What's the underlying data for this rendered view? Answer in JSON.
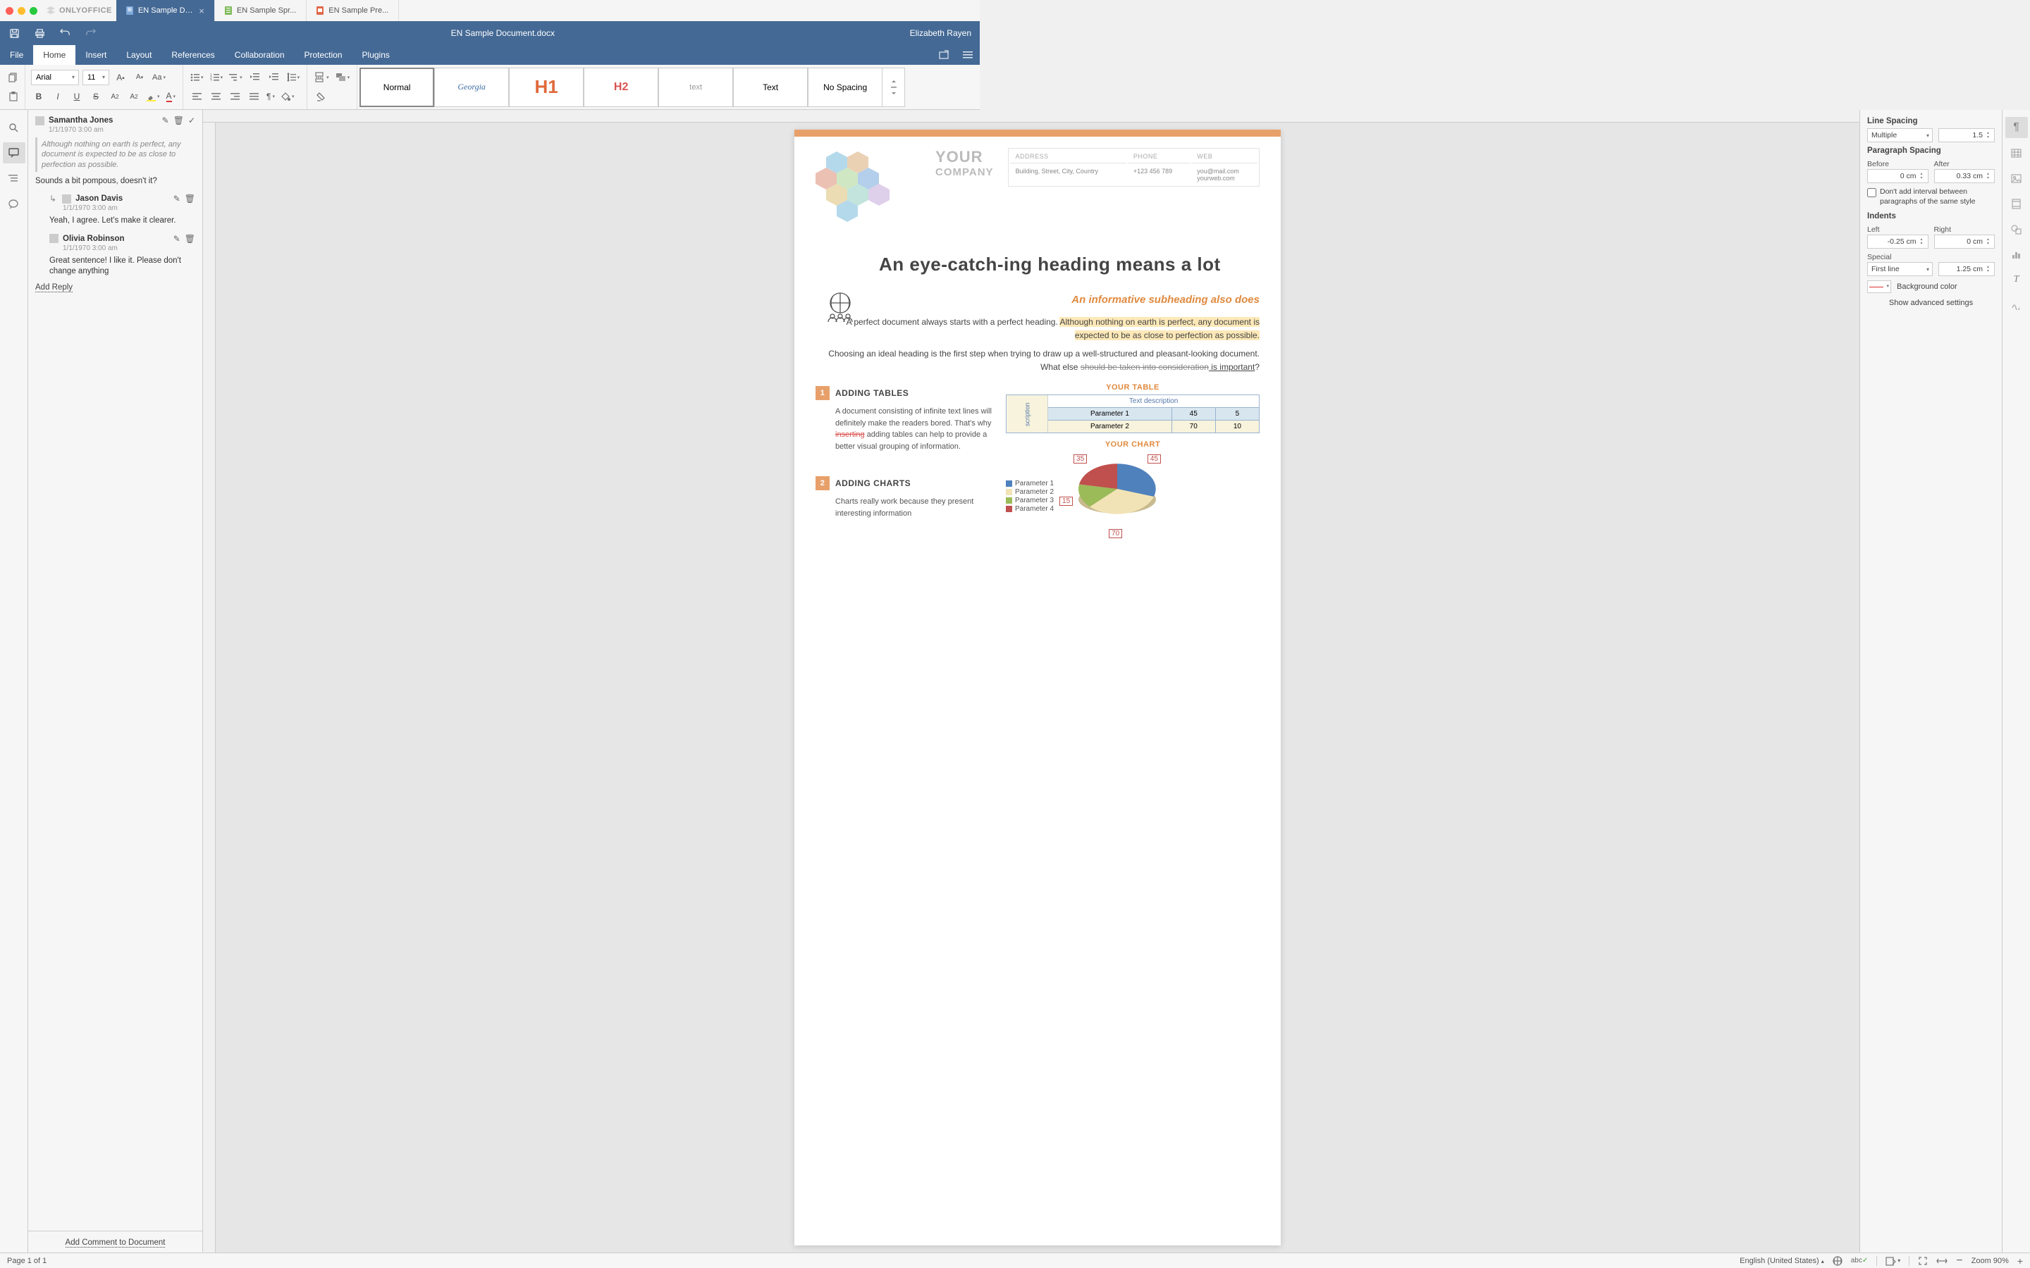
{
  "app": {
    "brand": "ONLYOFFICE"
  },
  "tabs": [
    {
      "label": "EN Sample Doc...",
      "type": "doc",
      "active": true
    },
    {
      "label": "EN Sample Spr...",
      "type": "sheet",
      "active": false
    },
    {
      "label": "EN Sample Pre...",
      "type": "pres",
      "active": false
    }
  ],
  "header": {
    "title": "EN Sample Document.docx",
    "user": "Elizabeth Rayen"
  },
  "menu": [
    "File",
    "Home",
    "Insert",
    "Layout",
    "References",
    "Collaboration",
    "Protection",
    "Plugins"
  ],
  "toolbar": {
    "font": "Arial",
    "fontSize": "11",
    "styles": [
      "Normal",
      "Georgia",
      "H1",
      "H2",
      "text",
      "Text",
      "No Spacing"
    ]
  },
  "comments": {
    "thread": {
      "author": "Samantha Jones",
      "date": "1/1/1970 3:00 am",
      "quote": "Although nothing on earth is perfect, any document is expected to be as close to perfection as possible.",
      "body": "Sounds a bit pompous, doesn't it?",
      "replies": [
        {
          "author": "Jason Davis",
          "date": "1/1/1970 3:00 am",
          "body": "Yeah, I agree. Let's make it clearer."
        },
        {
          "author": "Olivia Robinson",
          "date": "1/1/1970 3:00 am",
          "body": "Great sentence! I like it. Please don't change anything"
        }
      ]
    },
    "addReply": "Add Reply",
    "addComment": "Add Comment to Document"
  },
  "doc": {
    "your": "YOUR",
    "company": "COMPANY",
    "info": {
      "addressH": "ADDRESS",
      "phoneH": "PHONE",
      "webH": "WEB",
      "address": "Building, Street, City, Country",
      "phone": "+123 456 789",
      "web1": "you@mail.com",
      "web2": "yourweb.com"
    },
    "h1": "An eye-catch-ing heading means a lot",
    "sub": "An informative subheading also does",
    "p1a": "A perfect document always starts with a perfect heading. ",
    "p1b": "Although nothing on earth is perfect, any document is expected to be as close to perfection as possible.",
    "p2a": "Choosing an ideal heading is the first step when trying to draw up a well-structured and pleasant-looking document. What else ",
    "p2b": "should be taken into consideration",
    "p2c": " is important",
    "sec1num": "1",
    "sec1": "ADDING TABLES",
    "sec1body1": "A document consisting of infinite text lines will definitely make the readers bored. That's why ",
    "sec1ins": "inserting",
    "sec1body2": " adding tables can help to provide a better visual grouping of information.",
    "sec2num": "2",
    "sec2": "ADDING CHARTS",
    "sec2body": "Charts really work because they present interesting information",
    "tableCap": "YOUR TABLE",
    "chartCap": "YOUR CHART",
    "tbl": {
      "desc": "Text description",
      "vhead": "scription",
      "rows": [
        [
          "Parameter 1",
          "45",
          "5"
        ],
        [
          "Parameter 2",
          "70",
          "10"
        ]
      ]
    },
    "legend": [
      "Parameter 1",
      "Parameter 2",
      "Parameter 3",
      "Parameter 4"
    ]
  },
  "chart_data": {
    "type": "pie",
    "title": "YOUR CHART",
    "categories": [
      "Parameter 1",
      "Parameter 2",
      "Parameter 3",
      "Parameter 4"
    ],
    "values": [
      45,
      70,
      15,
      35
    ],
    "colors": [
      "#4f81bd",
      "#f2e3b6",
      "#9bbb59",
      "#c0504d"
    ],
    "data_labels": [
      45,
      70,
      15,
      35
    ]
  },
  "props": {
    "lineSpacingT": "Line Spacing",
    "lineSpacingMode": "Multiple",
    "lineSpacingVal": "1.5",
    "paraSpacingT": "Paragraph Spacing",
    "beforeT": "Before",
    "afterT": "After",
    "beforeVal": "0 cm",
    "afterVal": "0.33 cm",
    "dontAdd": "Don't add interval between paragraphs of the same style",
    "indentsT": "Indents",
    "leftT": "Left",
    "rightT": "Right",
    "leftVal": "-0.25 cm",
    "rightVal": "0 cm",
    "specialT": "Special",
    "specialMode": "First line",
    "specialVal": "1.25 cm",
    "bgT": "Background color",
    "adv": "Show advanced settings"
  },
  "status": {
    "page": "Page 1 of 1",
    "lang": "English (United States)",
    "zoom": "Zoom 90%"
  }
}
